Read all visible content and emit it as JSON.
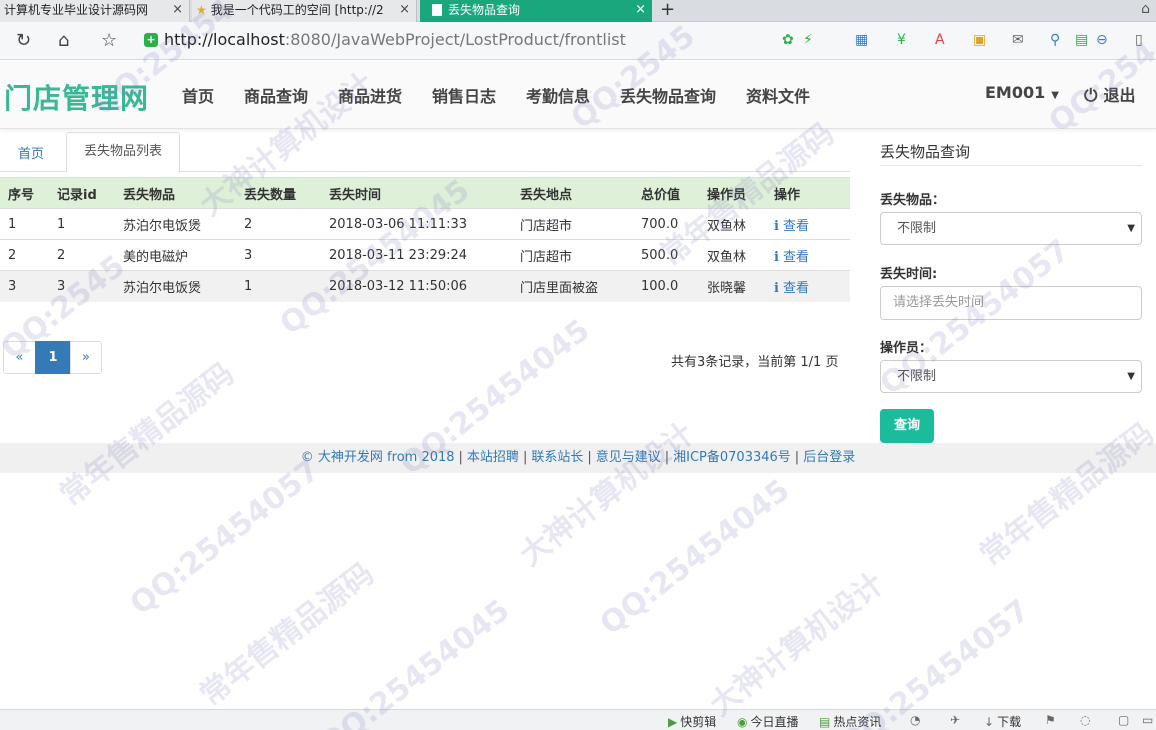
{
  "browser": {
    "tabs": [
      {
        "title": "计算机专业毕业设计源码网",
        "close": "×"
      },
      {
        "title": "我是一个代码工的空间 [http://2",
        "close": "×"
      },
      {
        "title": "丢失物品查询",
        "close": "×"
      }
    ],
    "new_tab": "+",
    "url_host": "http://localhost",
    "url_path": ":8080/JavaWebProject/LostProduct/frontlist"
  },
  "site": {
    "brand": "门店管理网",
    "nav": [
      "首页",
      "商品查询",
      "商品进货",
      "销售日志",
      "考勤信息",
      "丢失物品查询",
      "资料文件"
    ],
    "user": "EM001",
    "logout": "退出"
  },
  "crumbs": {
    "home": "首页",
    "active": "丢失物品列表"
  },
  "table": {
    "headers": [
      "序号",
      "记录id",
      "丢失物品",
      "丢失数量",
      "丢失时间",
      "丢失地点",
      "总价值",
      "操作员",
      "操作"
    ],
    "rows": [
      [
        "1",
        "1",
        "苏泊尔电饭煲",
        "2",
        "2018-03-06 11:11:33",
        "门店超市",
        "700.0",
        "双鱼林",
        "查看"
      ],
      [
        "2",
        "2",
        "美的电磁炉",
        "3",
        "2018-03-11 23:29:24",
        "门店超市",
        "500.0",
        "双鱼林",
        "查看"
      ],
      [
        "3",
        "3",
        "苏泊尔电饭煲",
        "1",
        "2018-03-12 11:50:06",
        "门店里面被盗",
        "100.0",
        "张晓馨",
        "查看"
      ]
    ]
  },
  "pager": {
    "prev": "«",
    "current": "1",
    "next": "»",
    "summary": "共有3条记录，当前第 1/1 页"
  },
  "search": {
    "title": "丢失物品查询",
    "product_label": "丢失物品：",
    "product_value": "不限制",
    "time_label": "丢失时间:",
    "time_placeholder": "请选择丢失时间",
    "operator_label": "操作员：",
    "operator_value": "不限制",
    "button": "查询"
  },
  "footer": {
    "links": [
      "© 大神开发网 from 2018",
      "本站招聘",
      "联系站长",
      "意见与建议",
      "湘ICP备0703346号",
      "后台登录"
    ]
  },
  "statusbar": {
    "items": [
      "快剪辑",
      "今日直播",
      "热点资讯",
      "下载"
    ]
  },
  "colors": {
    "brand": "#3ab795",
    "active_tab": "#1aa77e",
    "primary": "#337ab7",
    "search_button": "#1abc9c",
    "table_header": "#dff0d8"
  }
}
